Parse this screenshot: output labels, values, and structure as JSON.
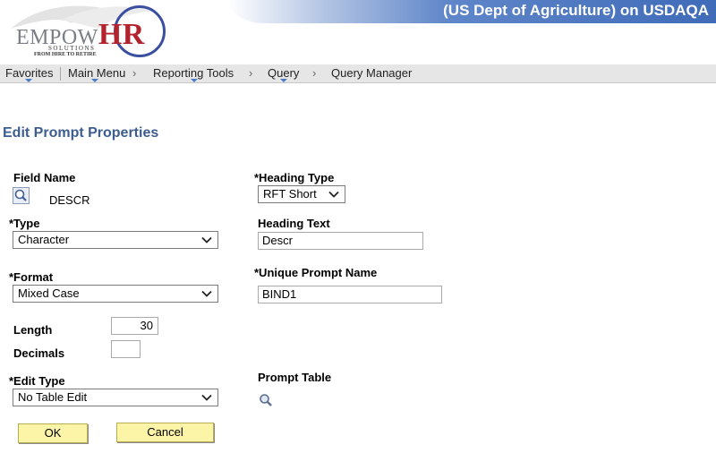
{
  "header": {
    "title": "(US Dept of Agriculture) on USDAQA",
    "logo": {
      "word_prefix": "Empow",
      "word_suffix": "HR",
      "sub": "SOLUTIONS",
      "tagline": "FROM HIRE TO RETIRE"
    }
  },
  "nav": {
    "favorites": "Favorites",
    "main_menu": "Main Menu",
    "reporting_tools": "Reporting Tools",
    "query": "Query",
    "query_manager": "Query Manager",
    "separator": "›"
  },
  "page": {
    "title": "Edit Prompt Properties"
  },
  "form": {
    "field_name_label": "Field Name",
    "field_name_value": "DESCR",
    "type_label": "*Type",
    "type_value": "Character",
    "format_label": "*Format",
    "format_value": "Mixed Case",
    "length_label": "Length",
    "length_value": "30",
    "decimals_label": "Decimals",
    "decimals_value": "",
    "edit_type_label": "*Edit Type",
    "edit_type_value": "No Table Edit",
    "heading_type_label": "*Heading Type",
    "heading_type_value": "RFT Short",
    "heading_text_label": "Heading Text",
    "heading_text_value": "Descr",
    "unique_prompt_label": "*Unique Prompt Name",
    "unique_prompt_value": "BIND1",
    "prompt_table_label": "Prompt Table"
  },
  "buttons": {
    "ok": "OK",
    "cancel": "Cancel"
  },
  "colors": {
    "accent_title": "#3d5d8f",
    "button_bg": "#fcf5a8",
    "banner_blue": "#3f6bb8",
    "logo_red": "#b2232e"
  },
  "icons": [
    "search-icon",
    "magnifier-icon",
    "chevron-down-icon",
    "nav-caret-icon"
  ]
}
